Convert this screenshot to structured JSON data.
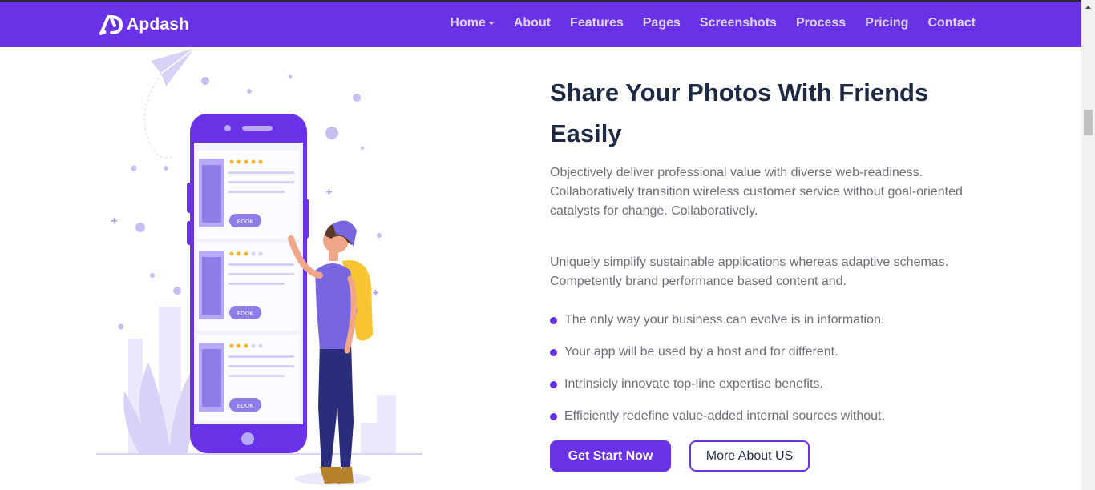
{
  "brand": {
    "name": "Apdash"
  },
  "nav": {
    "items": [
      {
        "label": "Home",
        "has_dropdown": true
      },
      {
        "label": "About"
      },
      {
        "label": "Features"
      },
      {
        "label": "Pages"
      },
      {
        "label": "Screenshots"
      },
      {
        "label": "Process"
      },
      {
        "label": "Pricing"
      },
      {
        "label": "Contact"
      }
    ]
  },
  "section": {
    "heading_line1": "Share Your Photos With Friends",
    "heading_line2": "Easily",
    "paragraph1_line1": "Objectively deliver professional value with diverse web-readiness.",
    "paragraph1_line2": "Collaboratively transition wireless customer service without goal-oriented",
    "paragraph1_line3": "catalysts for change. Collaboratively.",
    "paragraph2_line1": "Uniquely simplify sustainable applications whereas adaptive schemas.",
    "paragraph2_line2": "Competently brand performance based content and.",
    "bullets": [
      "The only way your business can evolve is in information.",
      "Your app will be used by a host and for different.",
      "Intrinsicly innovate top-line expertise benefits.",
      "Efficiently redefine value-added internal sources without."
    ],
    "primary_button": "Get Start Now",
    "secondary_button": "More About US"
  },
  "illustration": {
    "card_button_label": "BOOK",
    "ratings": [
      5,
      3,
      3
    ]
  },
  "colors": {
    "brand": "#6a32e6",
    "heading": "#1e2a44",
    "text": "#6e6e7a",
    "star": "#f7b42c"
  }
}
